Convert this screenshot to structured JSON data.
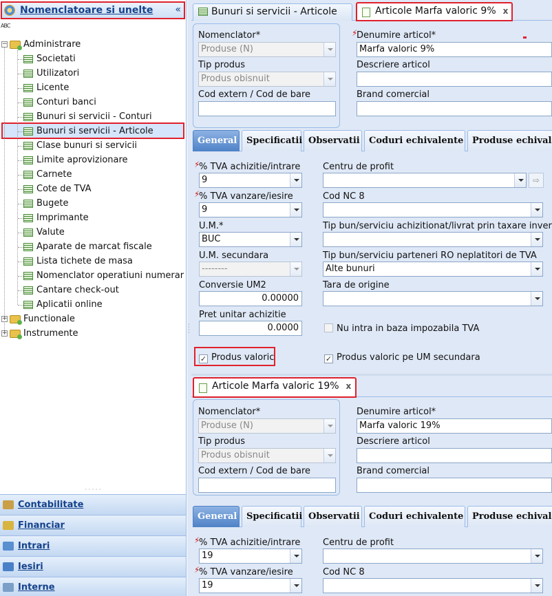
{
  "sidebar": {
    "title": "Nomenclatoare si unelte",
    "collapse": "«",
    "abc": "ABC",
    "root": "Administrare",
    "items": [
      "Societati",
      "Utilizatori",
      "Licente",
      "Conturi banci",
      "Bunuri si servicii - Conturi",
      "Bunuri si servicii - Articole",
      "Clase bunuri si servicii",
      "Limite aprovizionare",
      "Carnete",
      "Cote de TVA",
      "Bugete",
      "Imprimante",
      "Valute",
      "Aparate de marcat fiscale",
      "Lista tichete de masa",
      "Nomenclator operatiuni numerar",
      "Cantare check-out",
      "Aplicatii online"
    ],
    "folders": [
      "Functionale",
      "Instrumente"
    ],
    "modules": [
      "Contabilitate",
      "Financiar",
      "Intrari",
      "Iesiri",
      "Interne"
    ]
  },
  "tabs": {
    "tab1": "Bunuri si servicii - Articole",
    "tab2": "Articole Marfa valoric 9%",
    "tab3": "Articole Marfa valoric 19%",
    "close": "x"
  },
  "labels": {
    "nomenclator": "Nomenclator*",
    "tip_produs": "Tip produs",
    "cod_extern": "Cod extern / Cod de bare",
    "denumire": "Denumire articol*",
    "descriere": "Descriere articol",
    "brand": "Brand comercial",
    "tva_achizitie": "% TVA achizitie/intrare",
    "tva_vanzare": "% TVA vanzare/iesire",
    "um": "U.M.*",
    "um_secundara": "U.M. secundara",
    "conversie": "Conversie UM2",
    "pret": "Pret unitar achizitie",
    "centru": "Centru de profit",
    "cod_nc": "Cod NC 8",
    "tip_taxare": "Tip bun/serviciu achizitionat/livrat prin taxare inversa",
    "tip_parteneri": "Tip bun/serviciu parteneri RO neplatitori de TVA",
    "tara": "Tara de origine",
    "nu_intra": "Nu intra in baza impozabila TVA",
    "produs_valoric": "Produs valoric",
    "produs_valoric_um": "Produs valoric pe UM secundara"
  },
  "subtabs": [
    "General",
    "Specificatii",
    "Observatii",
    "Coduri echivalente",
    "Produse echivalente"
  ],
  "form1": {
    "nomenclator": "Produse (N)",
    "tip_produs": "Produs obisnuit",
    "cod_extern": "",
    "denumire": "Marfa valoric 9%",
    "tva_achizitie": "9",
    "tva_vanzare": "9",
    "um": "BUC",
    "um_secundara": "--------",
    "conversie": "0.00000",
    "pret": "0.0000",
    "tip_parteneri": "Alte bunuri",
    "produs_valoric": true,
    "produs_valoric_um": true,
    "nu_intra": false
  },
  "form2": {
    "nomenclator": "Produse (N)",
    "tip_produs": "Produs obisnuit",
    "denumire": "Marfa valoric 19%",
    "tva_achizitie": "19",
    "tva_vanzare": "19"
  },
  "icons": {
    "check": "✓",
    "goto": "⇨"
  }
}
